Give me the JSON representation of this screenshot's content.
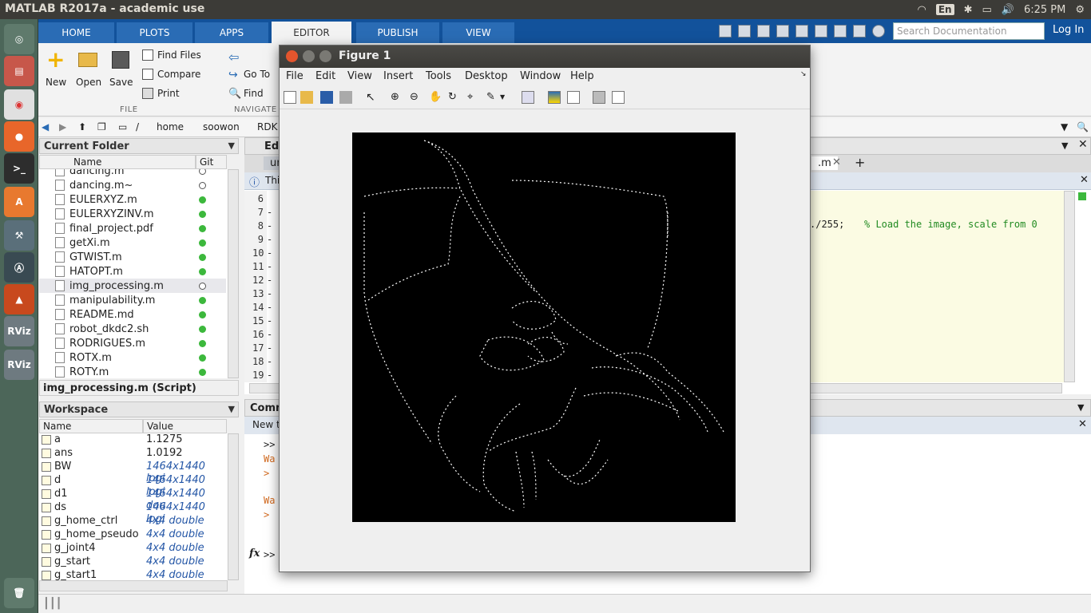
{
  "topbar": {
    "title": "MATLAB R2017a - academic use",
    "lang": "En",
    "time": "6:25 PM"
  },
  "ribbon": {
    "tabs": [
      "HOME",
      "PLOTS",
      "APPS",
      "EDITOR",
      "PUBLISH",
      "VIEW"
    ],
    "active_tab": "EDITOR",
    "search_placeholder": "Search Documentation",
    "login": "Log In",
    "file": {
      "new": "New",
      "open": "Open",
      "save": "Save",
      "find_files": "Find Files",
      "compare": "Compare",
      "print": "Print",
      "section": "FILE"
    },
    "navigate": {
      "goto": "Go To",
      "find": "Find",
      "section": "NAVIGATE"
    }
  },
  "address": {
    "root": "/",
    "path1": "home",
    "path2": "soowon",
    "path3": "RDK"
  },
  "current_folder": {
    "title": "Current Folder",
    "col_name": "Name",
    "col_git": "Git",
    "files": [
      {
        "name": "dancing.m",
        "git": "none"
      },
      {
        "name": "dancing.m~",
        "git": "none"
      },
      {
        "name": "EULERXYZ.m",
        "git": "ok"
      },
      {
        "name": "EULERXYZINV.m",
        "git": "ok"
      },
      {
        "name": "final_project.pdf",
        "git": "ok"
      },
      {
        "name": "getXi.m",
        "git": "ok"
      },
      {
        "name": "GTWIST.m",
        "git": "ok"
      },
      {
        "name": "HATOPT.m",
        "git": "ok"
      },
      {
        "name": "img_processing.m",
        "git": "none"
      },
      {
        "name": "manipulability.m",
        "git": "ok"
      },
      {
        "name": "README.md",
        "git": "ok"
      },
      {
        "name": "robot_dkdc2.sh",
        "git": "ok"
      },
      {
        "name": "RODRIGUES.m",
        "git": "ok"
      },
      {
        "name": "ROTX.m",
        "git": "ok"
      },
      {
        "name": "ROTY.m",
        "git": "ok"
      }
    ],
    "detail": "img_processing.m  (Script)"
  },
  "workspace": {
    "title": "Workspace",
    "col_name": "Name",
    "col_value": "Value",
    "vars": [
      {
        "name": "a",
        "value": "1.1275",
        "plain": true
      },
      {
        "name": "ans",
        "value": "1.0192",
        "plain": true
      },
      {
        "name": "BW",
        "value": "1464x1440 logi",
        "plain": false
      },
      {
        "name": "d",
        "value": "1464x1440 logi",
        "plain": false
      },
      {
        "name": "d1",
        "value": "1464x1440 dou",
        "plain": false
      },
      {
        "name": "ds",
        "value": "1464x1440 logi",
        "plain": false
      },
      {
        "name": "g_home_ctrl",
        "value": "4x4 double",
        "plain": false
      },
      {
        "name": "g_home_pseudo",
        "value": "4x4 double",
        "plain": false
      },
      {
        "name": "g_joint4",
        "value": "4x4 double",
        "plain": false
      },
      {
        "name": "g_start",
        "value": "4x4 double",
        "plain": false
      },
      {
        "name": "g_start1",
        "value": "4x4 double",
        "plain": false
      }
    ]
  },
  "editor": {
    "title": "Edi",
    "tab1": "un",
    "tab2": ".m",
    "info": "Thi",
    "line_numbers": [
      "6",
      "7",
      "8",
      "9",
      "10",
      "11",
      "12",
      "13",
      "14",
      "15",
      "16",
      "17",
      "18",
      "19"
    ],
    "code_visible": "./255;",
    "comment_visible": "% Load the image, scale from 0"
  },
  "command": {
    "title": "Comm",
    "new_to": "New t",
    "prompt": ">>",
    "warn1": "Wa",
    "arrow": ">",
    "warn2": "Wa",
    "fx_prompt": ">>"
  },
  "figure": {
    "title": "Figure 1",
    "menu": [
      "File",
      "Edit",
      "View",
      "Insert",
      "Tools",
      "Desktop",
      "Window",
      "Help"
    ]
  },
  "colors": {
    "matlab_blue": "#12529b",
    "launcher_green": "#4c6659",
    "git_ok": "#3cb83c",
    "var_value": "#2456a6"
  }
}
